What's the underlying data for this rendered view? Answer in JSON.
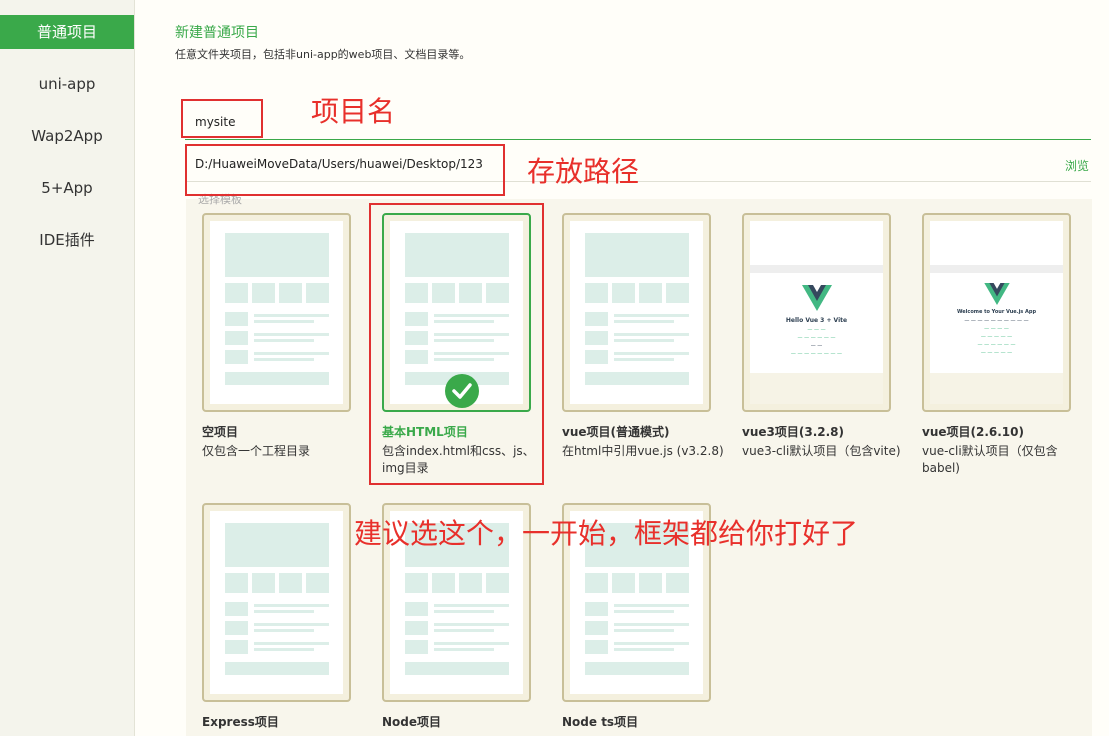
{
  "sidebar": {
    "items": [
      {
        "label": "普通项目",
        "active": true
      },
      {
        "label": "uni-app"
      },
      {
        "label": "Wap2App"
      },
      {
        "label": "5+App"
      },
      {
        "label": "IDE插件"
      }
    ]
  },
  "header": {
    "title": "新建普通项目",
    "description": "任意文件夹项目，包括非uni-app的web项目、文档目录等。"
  },
  "form": {
    "project_name": "mysite",
    "path": "D:/HuaweiMoveData/Users/huawei/Desktop/123",
    "browse_label": "浏览",
    "template_label": "选择模板"
  },
  "templates": [
    {
      "name": "空项目",
      "desc": "仅包含一个工程目录"
    },
    {
      "name": "基本HTML项目",
      "desc": "包含index.html和css、js、img目录",
      "selected": true
    },
    {
      "name": "vue项目(普通模式)",
      "desc": "在html中引用vue.js (v3.2.8)"
    },
    {
      "name": "vue3项目(3.2.8)",
      "desc": "vue3-cli默认项目（包含vite)",
      "preview_title": "Hello Vue 3 + Vite"
    },
    {
      "name": "vue项目(2.6.10)",
      "desc": "vue-cli默认项目（仅包含babel)",
      "preview_title": "Welcome to Your Vue.js App"
    },
    {
      "name": "Express项目",
      "desc": ""
    },
    {
      "name": "Node项目",
      "desc": ""
    },
    {
      "name": "Node ts项目",
      "desc": ""
    }
  ],
  "annotations": {
    "project_name": "项目名",
    "path": "存放路径",
    "recommend": "建议选这个，一开始，框架都给你打好了"
  },
  "colors": {
    "accent": "#3aa94a",
    "annotation": "#e03030",
    "card_border": "#c8bf98"
  }
}
